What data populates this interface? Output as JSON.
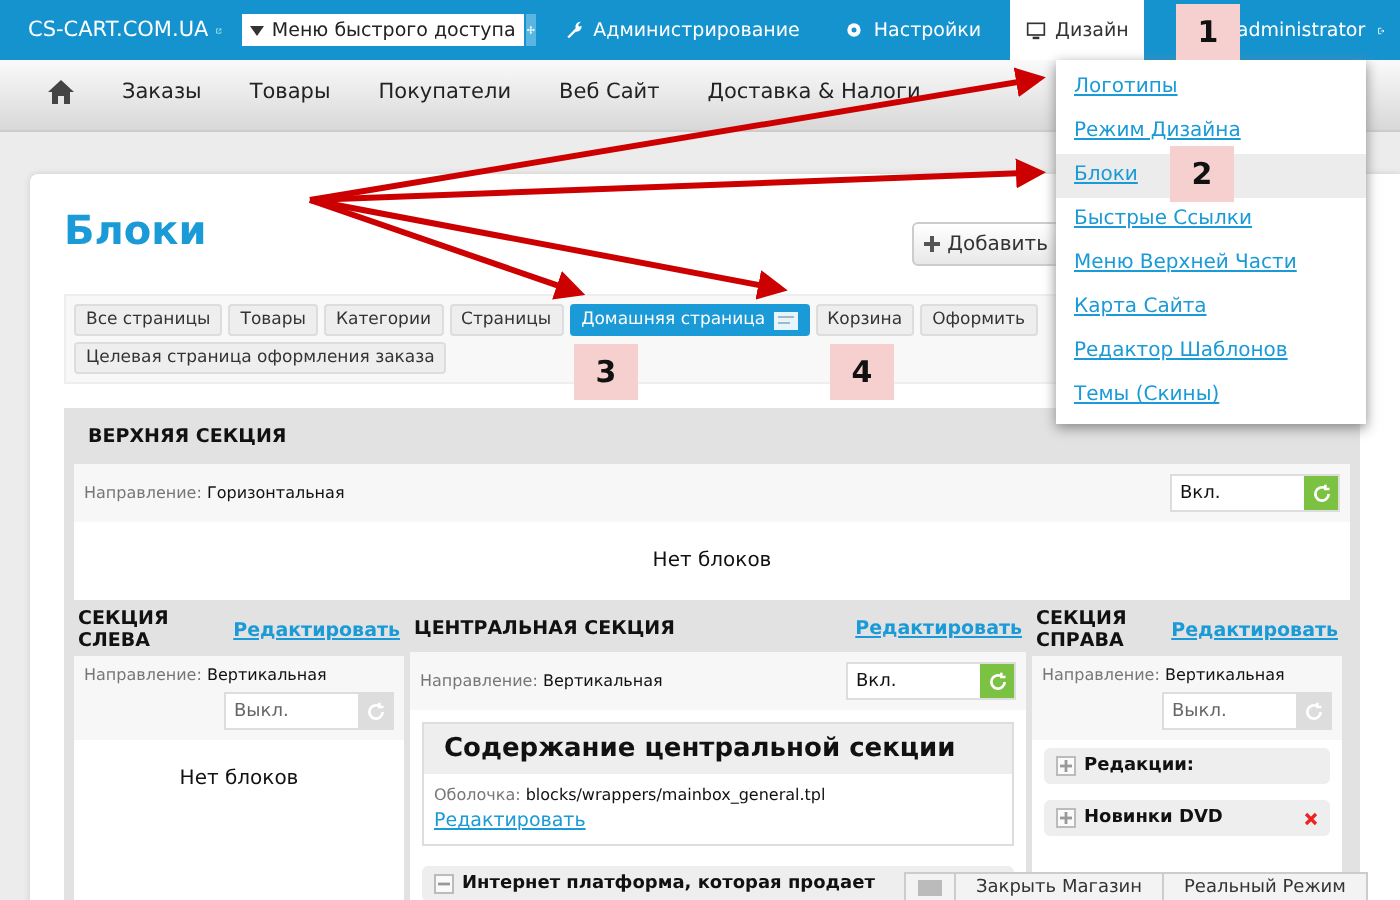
{
  "top_bar": {
    "site": "CS-CART.COM.UA",
    "quick_menu": "Меню быстрого доступа",
    "items": [
      {
        "label": "Администрирование",
        "selected": false
      },
      {
        "label": "Настройки",
        "selected": false
      },
      {
        "label": "Дизайн",
        "selected": true
      }
    ],
    "user": "administrator"
  },
  "nav": {
    "items": [
      "Заказы",
      "Товары",
      "Покупатели",
      "Веб Сайт",
      "Доставка & Налоги"
    ]
  },
  "page": {
    "title": "Блоки",
    "add_button": "Добавить"
  },
  "tabs": [
    {
      "label": "Все страницы",
      "selected": false
    },
    {
      "label": "Товары",
      "selected": false
    },
    {
      "label": "Категории",
      "selected": false
    },
    {
      "label": "Страницы",
      "selected": false
    },
    {
      "label": "Домашняя страница",
      "selected": true
    },
    {
      "label": "Корзина",
      "selected": false
    },
    {
      "label": "Оформить",
      "selected": false
    },
    {
      "label": "Целевая страница оформления заказа",
      "selected": false
    }
  ],
  "top_section": {
    "title": "ВЕРХНЯЯ СЕКЦИЯ",
    "direction_label": "Направление:",
    "direction": "Горизонтальная",
    "status": {
      "value": "Вкл.",
      "enabled": true
    },
    "empty": "Нет блоков"
  },
  "left_section": {
    "title": "СЕКЦИЯ СЛЕВА",
    "edit": "Редактировать",
    "direction_label": "Направление:",
    "direction": "Вертикальная",
    "status": {
      "value": "Выкл.",
      "enabled": false
    },
    "empty": "Нет блоков"
  },
  "center_section": {
    "title": "ЦЕНТРАЛЬНАЯ СЕКЦИЯ",
    "edit": "Редактировать",
    "direction_label": "Направление:",
    "direction": "Вертикальная",
    "status": {
      "value": "Вкл.",
      "enabled": true
    },
    "content_block": {
      "title": "Содержание центральной секции",
      "wrapper_label": "Оболочка:",
      "wrapper": "blocks/wrappers/mainbox_general.tpl",
      "edit": "Редактировать"
    },
    "blocks": [
      {
        "title": "Интернет платформа, которая продает",
        "expanded": true
      }
    ]
  },
  "right_section": {
    "title": "СЕКЦИЯ СПРАВА",
    "edit": "Редактировать",
    "direction_label": "Направление:",
    "direction": "Вертикальная",
    "status": {
      "value": "Выкл.",
      "enabled": false
    },
    "blocks": [
      {
        "title": "Редакции:",
        "expanded": false,
        "removable": false
      },
      {
        "title": "Новинки DVD",
        "expanded": false,
        "removable": true
      }
    ]
  },
  "bottom_bar": {
    "buttons": [
      "Закрыть Магазин",
      "Реальный Режим"
    ]
  },
  "design_menu": {
    "items": [
      {
        "label": "Логотипы",
        "selected": false
      },
      {
        "label": "Режим Дизайна",
        "selected": false
      },
      {
        "label": "Блоки",
        "selected": true
      },
      {
        "label": "Быстрые Ссылки",
        "selected": false
      },
      {
        "label": "Меню Верхней Части",
        "selected": false
      },
      {
        "label": "Карта Сайта",
        "selected": false
      },
      {
        "label": "Редактор Шаблонов",
        "selected": false
      },
      {
        "label": "Темы (Скины)",
        "selected": false
      }
    ]
  },
  "callouts": [
    "1",
    "2",
    "3",
    "4"
  ]
}
